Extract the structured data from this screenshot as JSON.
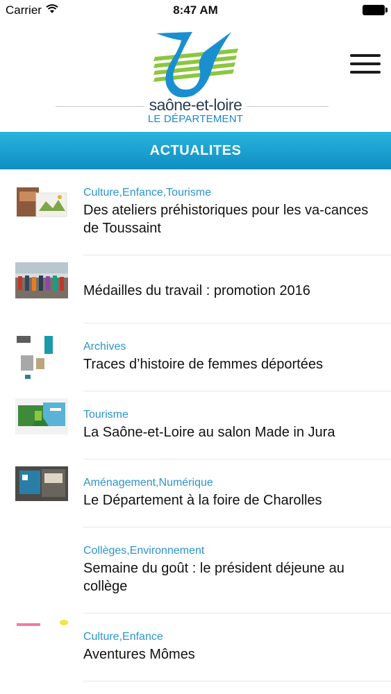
{
  "status_bar": {
    "carrier": "Carrier",
    "time": "8:47 AM"
  },
  "header": {
    "logo_name": "saône-et-loire",
    "logo_sub": "LE DÉPARTEMENT"
  },
  "section": {
    "title": "ACTUALITES"
  },
  "news": [
    {
      "category": "Culture,Enfance,Tourisme",
      "title": "Des ateliers préhistoriques pour les va-cances de Toussaint"
    },
    {
      "category": "",
      "title": "Médailles du travail : promotion 2016"
    },
    {
      "category": "Archives",
      "title": "Traces d’histoire de femmes déportées"
    },
    {
      "category": "Tourisme",
      "title": "La Saône-et-Loire au salon Made in Jura"
    },
    {
      "category": "Aménagement,Numérique",
      "title": "Le Département à la foire de Charolles"
    },
    {
      "category": "Collèges,Environnement",
      "title": "Semaine du goût : le président déjeune au collège"
    },
    {
      "category": "Culture,Enfance",
      "title": "Aventures Mômes"
    }
  ],
  "colors": {
    "accent": "#1a9fd3",
    "category": "#2b93cf",
    "logo_green": "#8cc63f",
    "logo_blue": "#1a8fd0"
  }
}
